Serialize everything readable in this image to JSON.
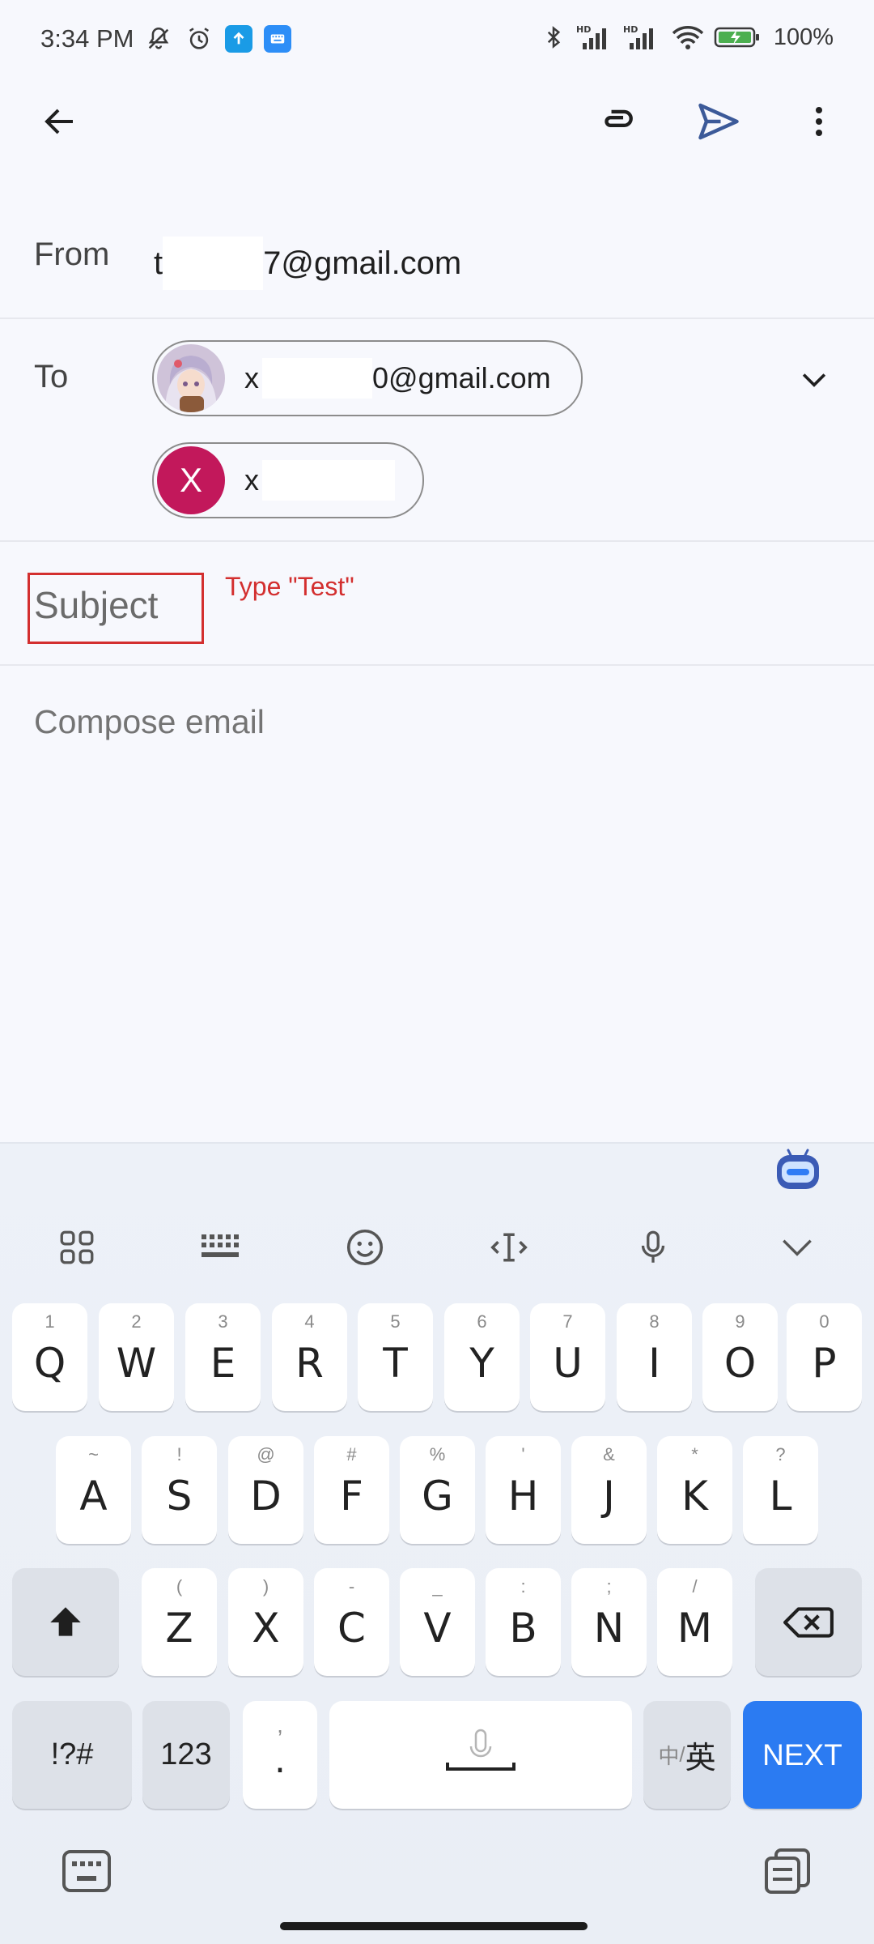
{
  "status_bar": {
    "time": "3:34 PM",
    "battery_text": "100%"
  },
  "toolbar": {
    "back_icon": "arrow-back-icon",
    "attach_icon": "paperclip-icon",
    "send_icon": "send-icon",
    "more_icon": "more-vert-icon"
  },
  "compose": {
    "from_label": "From",
    "from_prefix": "t",
    "from_suffix": "7@gmail.com",
    "to_label": "To",
    "recipients": [
      {
        "prefix": "x",
        "suffix": "0@gmail.com",
        "avatar": "anime-avatar"
      },
      {
        "prefix": "x",
        "suffix": "",
        "avatar_letter": "X"
      }
    ],
    "subject_placeholder": "Subject",
    "body_placeholder": "Compose email"
  },
  "annotation": {
    "text": "Type \"Test\"",
    "color": "#d32f2f"
  },
  "keyboard": {
    "row1": [
      {
        "ch": "Q",
        "hint": "1"
      },
      {
        "ch": "W",
        "hint": "2"
      },
      {
        "ch": "E",
        "hint": "3"
      },
      {
        "ch": "R",
        "hint": "4"
      },
      {
        "ch": "T",
        "hint": "5"
      },
      {
        "ch": "Y",
        "hint": "6"
      },
      {
        "ch": "U",
        "hint": "7"
      },
      {
        "ch": "I",
        "hint": "8"
      },
      {
        "ch": "O",
        "hint": "9"
      },
      {
        "ch": "P",
        "hint": "0"
      }
    ],
    "row2": [
      {
        "ch": "A",
        "hint": "~"
      },
      {
        "ch": "S",
        "hint": "!"
      },
      {
        "ch": "D",
        "hint": "@"
      },
      {
        "ch": "F",
        "hint": "#"
      },
      {
        "ch": "G",
        "hint": "%"
      },
      {
        "ch": "H",
        "hint": "'"
      },
      {
        "ch": "J",
        "hint": "&"
      },
      {
        "ch": "K",
        "hint": "*"
      },
      {
        "ch": "L",
        "hint": "?"
      }
    ],
    "row3": [
      {
        "ch": "Z",
        "hint": "("
      },
      {
        "ch": "X",
        "hint": ")"
      },
      {
        "ch": "C",
        "hint": "-"
      },
      {
        "ch": "V",
        "hint": "_"
      },
      {
        "ch": "B",
        "hint": ":"
      },
      {
        "ch": "N",
        "hint": ";"
      },
      {
        "ch": "M",
        "hint": "/"
      }
    ],
    "symbols_label": "!?#",
    "numbers_label": "123",
    "comma_hint": ",",
    "period_label": ".",
    "lang_label_small": "中",
    "lang_label_sep": "/",
    "lang_label_big": "英",
    "next_label": "NEXT",
    "accent_color": "#2b7bf2"
  }
}
